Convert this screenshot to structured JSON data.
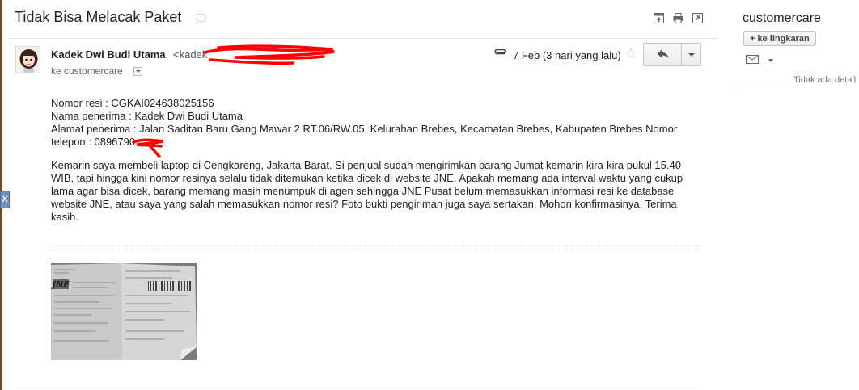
{
  "message": {
    "subject": "Tidak Bisa Melacak Paket",
    "sender_name": "Kadek Dwi Budi Utama",
    "sender_email_prefix": "<kadek",
    "recipient": "ke customercare",
    "date": "7 Feb (3 hari yang lalu)",
    "body_lines": [
      "Nomor resi : CGKAI024638025156",
      "Nama penerima : Kadek Dwi Budi Utama",
      "Alamat penerima : Jalan Saditan Baru Gang Mawar 2 RT.06/RW.05, Kelurahan Brebes, Kecamatan Brebes, Kabupaten Brebes Nomor",
      "telepon : 0896790"
    ],
    "body_paragraph": "Kemarin saya membeli laptop di Cengkareng, Jakarta Barat. Si penjual sudah mengirimkan barang Jumat kemarin kira-kira pukul 15.40 WIB, tapi hingga kini nomor resinya selalu tidak ditemukan ketika dicek di website JNE. Apakah memang ada interval waktu yang cukup lama agar bisa dicek, barang memang masih menumpuk di agen sehingga JNE Pusat belum memasukkan informasi resi ke database website JNE, atau saya yang salah memasukkan nomor resi? Foto bukti pengiriman juga saya sertakan. Mohon konfirmasinya. Terima kasih.",
    "attachment_logo": "JNE"
  },
  "sidebar": {
    "contact_name": "customercare",
    "add_circle_label": "+ ke lingkaran",
    "no_detail": "Tidak ada detail"
  },
  "extension": {
    "label": "X"
  },
  "icons": {
    "label": "label-icon",
    "new_window": "new-window-icon",
    "print": "print-icon",
    "popout": "popout-icon",
    "paperclip": "paperclip-icon",
    "star": "star-icon",
    "reply": "reply-icon",
    "mail": "mail-icon"
  },
  "colors": {
    "redaction": "#ff0000",
    "reply_button": "#f1f1f1"
  }
}
